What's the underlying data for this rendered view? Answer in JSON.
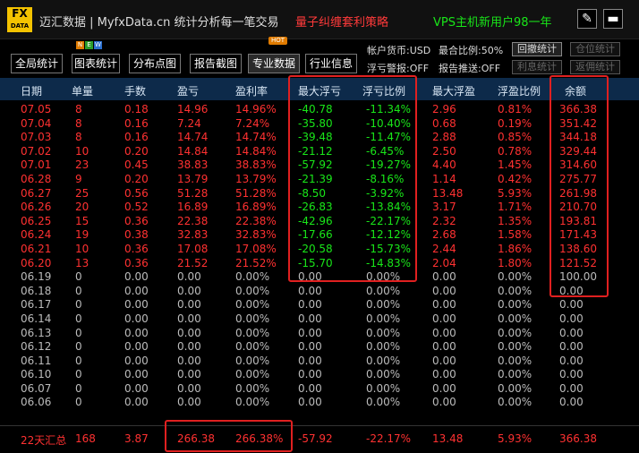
{
  "app": {
    "logo_top": "FX",
    "logo_bottom": "DATA",
    "title": "迈汇数据 | MyfxData.cn  统计分析每一笔交易",
    "promo_red": "量子纠缠套利策略",
    "promo_green": "VPS主机新用户98一年",
    "edit_glyph": "✎",
    "min_glyph": "▬"
  },
  "toolbar": {
    "buttons": [
      "全局统计",
      "图表统计",
      "分布点图",
      "报告截图",
      "专业数据",
      "行业信息"
    ],
    "badge_new": [
      "N",
      "E",
      "W"
    ],
    "badge_hot": "HOT",
    "currency_label": "帐户货币:USD",
    "close_ratio_label": "最合比例:50%",
    "float_alert_label": "浮亏警报:OFF",
    "report_push_label": "报告推送:OFF",
    "btn_drawdown": "回撤统计",
    "btn_position": "仓位统计",
    "btn_interest": "利息统计",
    "btn_rebate": "返佣统计"
  },
  "table": {
    "headers": [
      "日期",
      "单量",
      "手数",
      "盈亏",
      "盈利率",
      "最大浮亏",
      "浮亏比例",
      "最大浮盈",
      "浮盈比例",
      "余额"
    ],
    "rows": [
      [
        "07.05",
        "8",
        "0.18",
        "14.96",
        "14.96%",
        "-40.78",
        "-11.34%",
        "2.96",
        "0.81%",
        "366.38"
      ],
      [
        "07.04",
        "8",
        "0.16",
        "7.24",
        "7.24%",
        "-35.80",
        "-10.40%",
        "0.68",
        "0.19%",
        "351.42"
      ],
      [
        "07.03",
        "8",
        "0.16",
        "14.74",
        "14.74%",
        "-39.48",
        "-11.47%",
        "2.88",
        "0.85%",
        "344.18"
      ],
      [
        "07.02",
        "10",
        "0.20",
        "14.84",
        "14.84%",
        "-21.12",
        "-6.45%",
        "2.50",
        "0.78%",
        "329.44"
      ],
      [
        "07.01",
        "23",
        "0.45",
        "38.83",
        "38.83%",
        "-57.92",
        "-19.27%",
        "4.40",
        "1.45%",
        "314.60"
      ],
      [
        "06.28",
        "9",
        "0.20",
        "13.79",
        "13.79%",
        "-21.39",
        "-8.16%",
        "1.14",
        "0.42%",
        "275.77"
      ],
      [
        "06.27",
        "25",
        "0.56",
        "51.28",
        "51.28%",
        "-8.50",
        "-3.92%",
        "13.48",
        "5.93%",
        "261.98"
      ],
      [
        "06.26",
        "20",
        "0.52",
        "16.89",
        "16.89%",
        "-26.83",
        "-13.84%",
        "3.17",
        "1.71%",
        "210.70"
      ],
      [
        "06.25",
        "15",
        "0.36",
        "22.38",
        "22.38%",
        "-42.96",
        "-22.17%",
        "2.32",
        "1.35%",
        "193.81"
      ],
      [
        "06.24",
        "19",
        "0.38",
        "32.83",
        "32.83%",
        "-17.66",
        "-12.12%",
        "2.68",
        "1.58%",
        "171.43"
      ],
      [
        "06.21",
        "10",
        "0.36",
        "17.08",
        "17.08%",
        "-20.58",
        "-15.73%",
        "2.44",
        "1.86%",
        "138.60"
      ],
      [
        "06.20",
        "13",
        "0.36",
        "21.52",
        "21.52%",
        "-15.70",
        "-14.83%",
        "2.04",
        "1.80%",
        "121.52"
      ],
      [
        "06.19",
        "0",
        "0.00",
        "0.00",
        "0.00%",
        "0.00",
        "0.00%",
        "0.00",
        "0.00%",
        "100.00"
      ],
      [
        "06.18",
        "0",
        "0.00",
        "0.00",
        "0.00%",
        "0.00",
        "0.00%",
        "0.00",
        "0.00%",
        "0.00"
      ],
      [
        "06.17",
        "0",
        "0.00",
        "0.00",
        "0.00%",
        "0.00",
        "0.00%",
        "0.00",
        "0.00%",
        "0.00"
      ],
      [
        "06.14",
        "0",
        "0.00",
        "0.00",
        "0.00%",
        "0.00",
        "0.00%",
        "0.00",
        "0.00%",
        "0.00"
      ],
      [
        "06.13",
        "0",
        "0.00",
        "0.00",
        "0.00%",
        "0.00",
        "0.00%",
        "0.00",
        "0.00%",
        "0.00"
      ],
      [
        "06.12",
        "0",
        "0.00",
        "0.00",
        "0.00%",
        "0.00",
        "0.00%",
        "0.00",
        "0.00%",
        "0.00"
      ],
      [
        "06.11",
        "0",
        "0.00",
        "0.00",
        "0.00%",
        "0.00",
        "0.00%",
        "0.00",
        "0.00%",
        "0.00"
      ],
      [
        "06.10",
        "0",
        "0.00",
        "0.00",
        "0.00%",
        "0.00",
        "0.00%",
        "0.00",
        "0.00%",
        "0.00"
      ],
      [
        "06.07",
        "0",
        "0.00",
        "0.00",
        "0.00%",
        "0.00",
        "0.00%",
        "0.00",
        "0.00%",
        "0.00"
      ],
      [
        "06.06",
        "0",
        "0.00",
        "0.00",
        "0.00%",
        "0.00",
        "0.00%",
        "0.00",
        "0.00%",
        "0.00"
      ]
    ],
    "summary": [
      "22天汇总",
      "168",
      "3.87",
      "266.38",
      "266.38%",
      "-57.92",
      "-22.17%",
      "13.48",
      "5.93%",
      "366.38"
    ]
  },
  "colors": {
    "loss_red": "#ff3131",
    "gain_green": "#19e619",
    "neutral": "#bbbbbb",
    "header_bg": "#0d2a4a",
    "highlight": "#e02020"
  }
}
